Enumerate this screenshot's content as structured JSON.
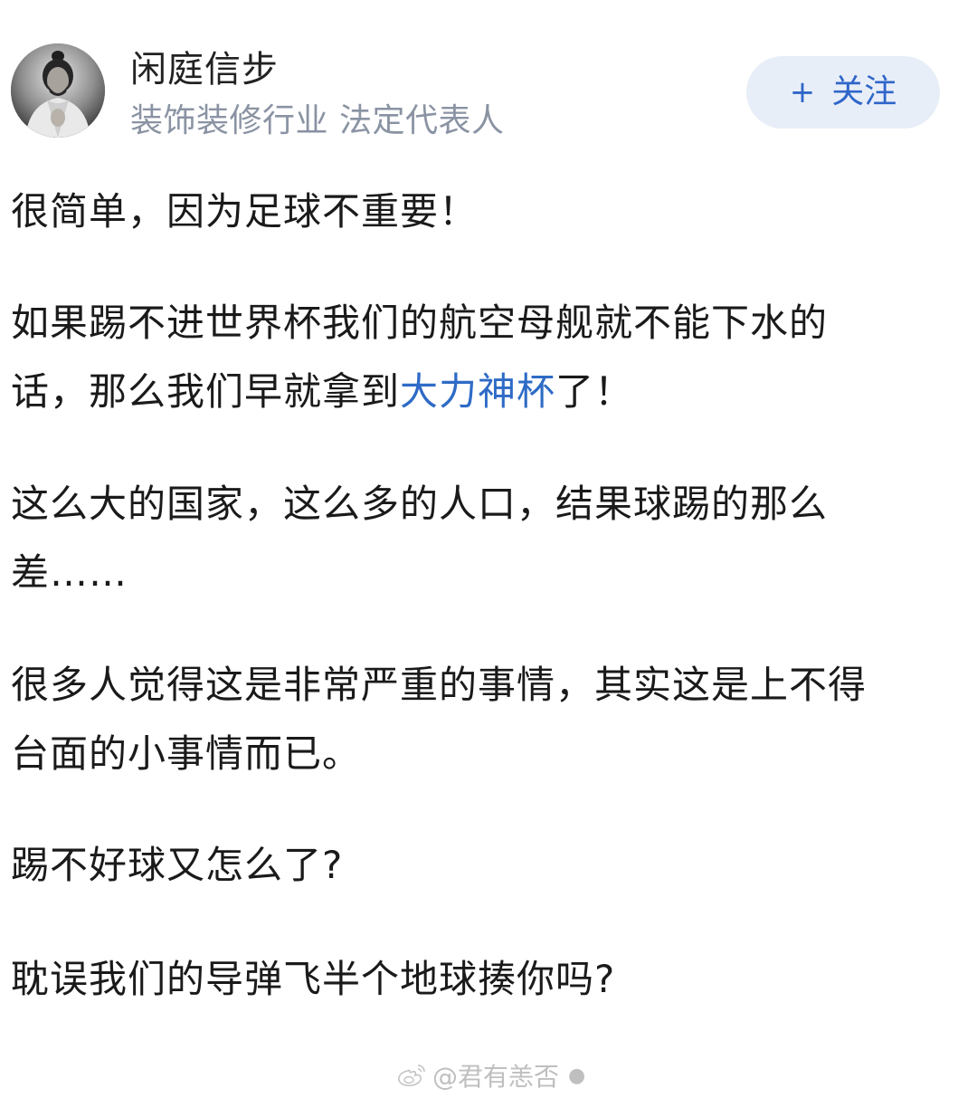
{
  "author": {
    "name": "闲庭信步",
    "description": "装饰装修行业 法定代表人"
  },
  "follow_button": {
    "plus": "+",
    "label": "关注"
  },
  "post": {
    "p1": "很简单，因为足球不重要！",
    "p2_line1": "如果踢不进世界杯我们的航空母舰就不能下水的",
    "p2_line2_before": "话，那么我们早就拿到",
    "p2_link": "大力神杯",
    "p2_line2_after": "了！",
    "p3_line1": "这么大的国家，这么多的人口，结果球踢的那么",
    "p3_line2": "差……",
    "p4_line1": "很多人觉得这是非常严重的事情，其实这是上不得",
    "p4_line2": "台面的小事情而已。",
    "p5": "踢不好球又怎么了?",
    "p6": "耽误我们的导弹飞半个地球揍你吗?"
  },
  "watermark": {
    "text": "@君有恙否"
  },
  "colors": {
    "link": "#2e6bc6",
    "follow_bg": "#e8eef8",
    "desc": "#8a93a3"
  }
}
